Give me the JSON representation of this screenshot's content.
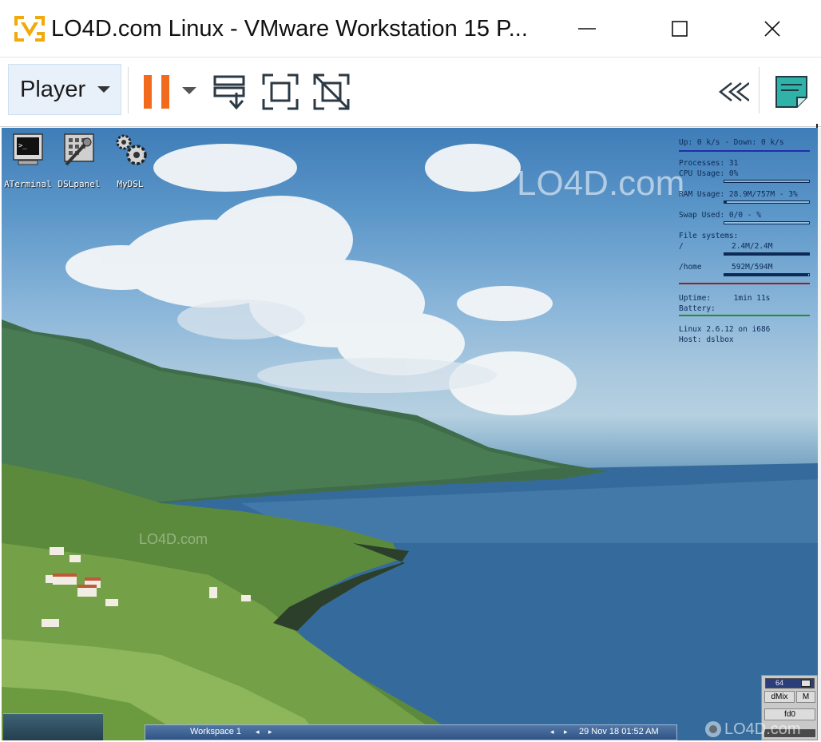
{
  "window": {
    "title": "LO4D.com Linux - VMware Workstation 15 P..."
  },
  "toolbar": {
    "player_label": "Player"
  },
  "desktop_icons": [
    {
      "label": "ATerminal",
      "icon": "terminal-icon"
    },
    {
      "label": "DSLpanel",
      "icon": "control-panel-icon"
    },
    {
      "label": "MyDSL",
      "icon": "gears-icon"
    }
  ],
  "sysmon": {
    "net": "Up: 0 k/s - Down: 0 k/s",
    "processes": "Processes: 31",
    "cpu": "CPU Usage: 0%",
    "cpu_level": 0,
    "ram": "RAM Usage: 28.9M/757M - 3%",
    "ram_level": 0.03,
    "swap": "Swap Used: 0/0 - %",
    "swap_level": 0,
    "fs_title": "File systems:",
    "fs_root_name": "/",
    "fs_root_value": "2.4M/2.4M",
    "fs_root_level": 1.0,
    "fs_home_name": "/home",
    "fs_home_value": "592M/594M",
    "fs_home_level": 0.99,
    "uptime": "Uptime:     1min 11s",
    "battery": "Battery:",
    "kernel": "Linux 2.6.12 on i686",
    "host": "Host: dslbox",
    "colors": {
      "net_rule": "#1d2fa8",
      "fs_rule": "#9a1f1f",
      "uptime_rule": "#2a8a2a"
    }
  },
  "watermark": {
    "text": "LO4D.com"
  },
  "taskbar": {
    "workspace": "Workspace 1",
    "clock": "29 Nov 18 01:52 AM"
  },
  "dock": {
    "volume": "64",
    "dmix": "dMix",
    "m": "M",
    "fd0": "fd0"
  },
  "colors": {
    "pause_orange": "#f26b1d",
    "icon_dark": "#2b3a44",
    "note_teal": "#2fb2a8"
  }
}
